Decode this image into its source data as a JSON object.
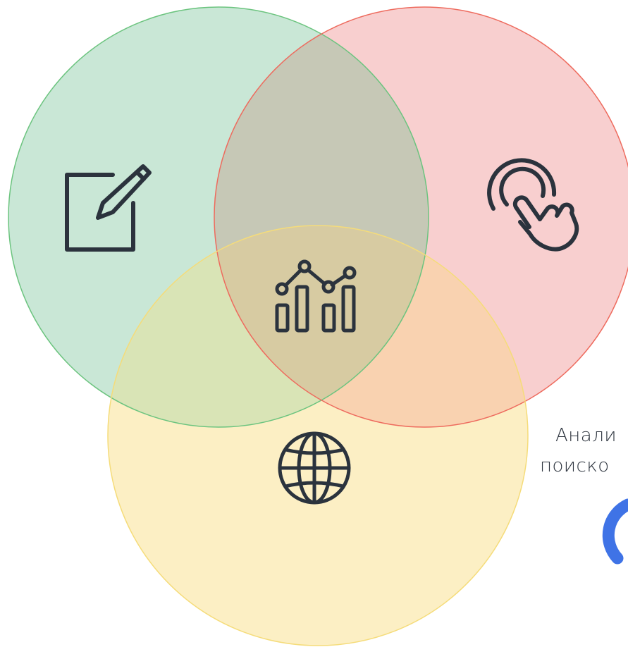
{
  "diagram": {
    "type": "venn",
    "sets": [
      {
        "id": "green",
        "fill": "#c9e7d6",
        "stroke": "#6cc47f",
        "icon": "edit-note-icon"
      },
      {
        "id": "red",
        "fill": "#f8cfcf",
        "stroke": "#ee6b5e",
        "icon": "touch-click-icon"
      },
      {
        "id": "yellow",
        "fill": "#fcefc4",
        "stroke": "#f5dc7a",
        "icon": "globe-icon"
      }
    ],
    "center_icon": "analytics-chart-icon",
    "icon_color": "#2b333d",
    "overlap_colors": {
      "green_red": "#c6c8b6",
      "green_yellow": "#d9e4b6",
      "red_yellow": "#f9d2b0",
      "all": "#d7cba2"
    }
  },
  "caption": {
    "line1": "Анали",
    "line2": "поиско"
  },
  "partial_logo": {
    "icon": "partial-ring-logo-icon",
    "color": "#3f73e6"
  }
}
